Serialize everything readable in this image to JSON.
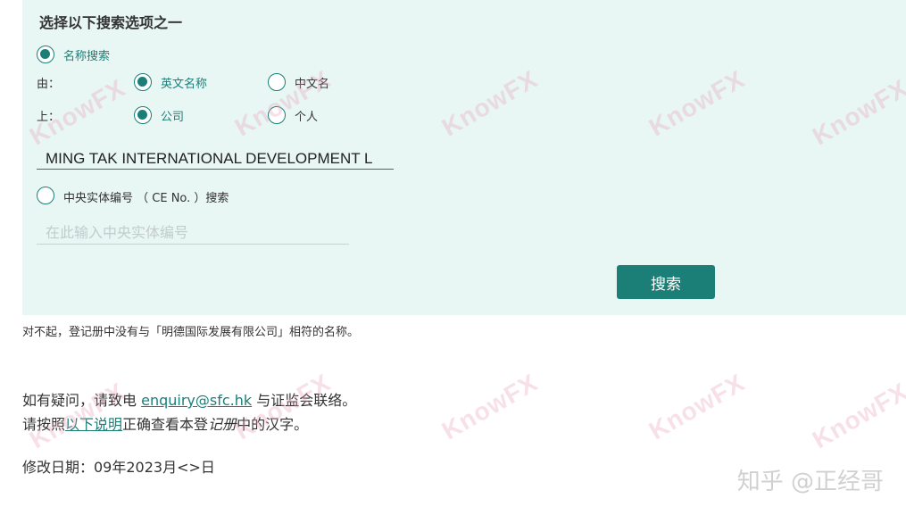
{
  "panel": {
    "title": "选择以下搜索选项之一",
    "name_search_label": "名称搜索",
    "by_label": "由：",
    "on_label": "上：",
    "english_name_label": "英文名称",
    "chinese_name_label": "中文名",
    "company_label": "公司",
    "individual_label": "个人",
    "name_value": "MING TAK INTERNATIONAL DEVELOPMENT L",
    "ce_search_label": "中央实体编号 （ CE No. ）搜索",
    "ce_placeholder": "在此输入中央实体编号",
    "search_button": "搜索"
  },
  "result_message": "对不起，登记册中没有与「明德国际发展有限公司」相符的名称。",
  "contact": {
    "line1_before": "如有疑问，请致电 ",
    "email": "enquiry@sfc.hk",
    "line1_after": " 与证监会联络。",
    "line2_before": "请按照",
    "link_text": "以下说明",
    "line2_middle": "正确查看本登",
    "line2_italic": "记册",
    "line2_after": "中的汉字。",
    "modified": "修改日期：09年2023月<>日"
  },
  "watermark_text": "KnowFX",
  "credit_text": "知乎 @正经哥",
  "colors": {
    "accent": "#1b7f78",
    "panel_bg": "#e8f6f4"
  }
}
